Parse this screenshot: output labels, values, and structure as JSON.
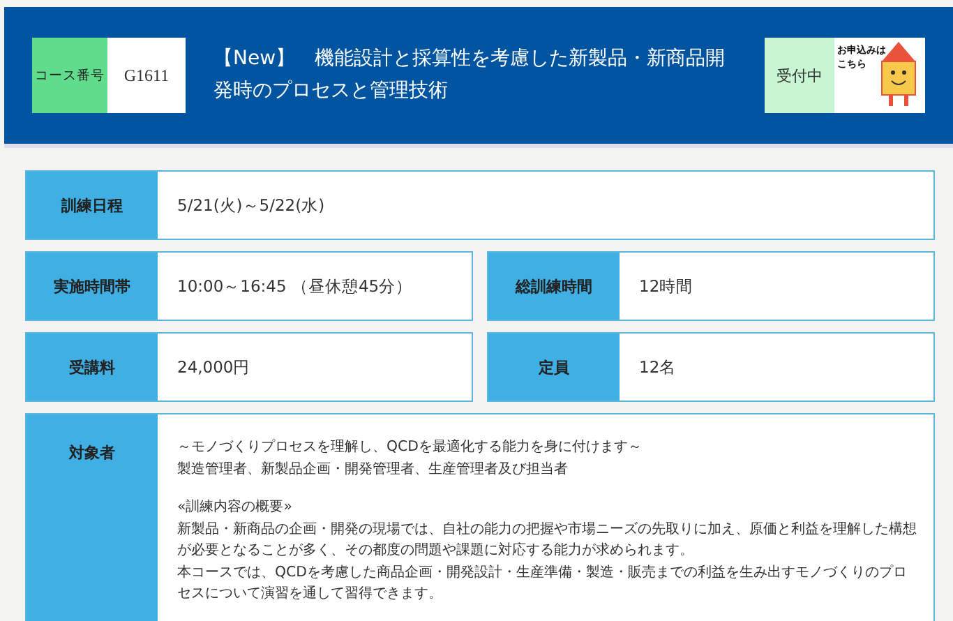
{
  "header": {
    "course_number_label": "コース番号",
    "course_number": "G1611",
    "title": "【New】　機能設計と採算性を考慮した新製品・新商品開発時のプロセスと管理技術",
    "status": "受付中",
    "apply_banner": [
      "お申込みは",
      "こちら"
    ]
  },
  "rows": [
    {
      "cells": [
        {
          "label": "訓練日程",
          "value": "5/21(火)～5/22(水)"
        }
      ]
    },
    {
      "cells": [
        {
          "label": "実施時間帯",
          "value": "10:00～16:45 （昼休憩45分）"
        },
        {
          "label": "総訓練時間",
          "value": "12時間"
        }
      ]
    },
    {
      "cells": [
        {
          "label": "受講料",
          "value": "24,000円"
        },
        {
          "label": "定員",
          "value": "12名"
        }
      ]
    }
  ],
  "target": {
    "label": "対象者",
    "paragraphs": [
      [
        "～モノづくりプロセスを理解し、QCDを最適化する能力を身に付けます～",
        "製造管理者、新製品企画・開発管理者、生産管理者及び担当者"
      ],
      [
        "«訓練内容の概要»",
        "新製品・新商品の企画・開発の現場では、自社の能力の把握や市場ニーズの先取りに加え、原価と利益を理解した構想が必要となることが多く、その都度の問題や課題に対応する能力が求められます。",
        "本コースでは、QCDを考慮した商品企画・開発設計・生産準備・製造・販売までの利益を生み出すモノづくりのプロセスについて演習を通して習得できます。"
      ]
    ]
  }
}
